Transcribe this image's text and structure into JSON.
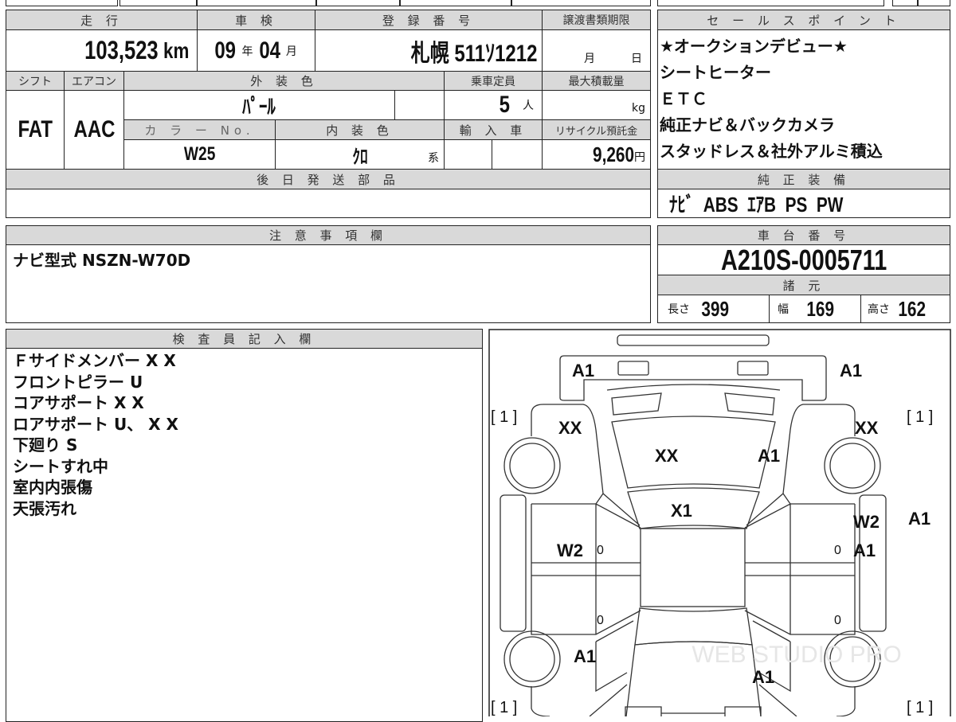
{
  "vehicle_table": {
    "mileage_header": "走 行",
    "mileage_value": "103,523",
    "mileage_unit": "km",
    "inspection_header": "車 検",
    "inspection_year": "09",
    "inspection_year_unit": "年",
    "inspection_month": "04",
    "inspection_month_unit": "月",
    "registration_header": "登 録 番 号",
    "registration_value": "札幌 511ｿ1212",
    "transfer_deadline_header": "譲渡書類期限",
    "transfer_month_unit": "月",
    "transfer_day_unit": "日",
    "shift_header": "シフト",
    "shift_value": "FAT",
    "aircon_header": "エアコン",
    "aircon_value": "AAC",
    "exterior_color_header": "外 装 色",
    "exterior_color_value": "ﾊﾟｰﾙ",
    "capacity_header": "乗車定員",
    "capacity_value": "5",
    "capacity_unit": "人",
    "max_load_header": "最大積載量",
    "max_load_unit": "kg",
    "color_no_header": "カ ラ ー No.",
    "color_no_value": "W25",
    "interior_color_header": "内 装 色",
    "interior_color_value": "ｸﾛ",
    "interior_color_suffix": "系",
    "import_header": "輸 入 車",
    "recycle_header": "リサイクル預託金",
    "recycle_value": "9,260",
    "recycle_unit": "円",
    "later_parts_header": "後 日 発 送 部 品"
  },
  "sales_points": {
    "header": "セ ー ル ス ポ イ ン ト",
    "items": [
      "★オークションデビュー★",
      "シートヒーター",
      "ＥＴＣ",
      "純正ナビ＆バックカメラ",
      "スタッドレス＆社外アルミ積込"
    ],
    "equipment_header": "純 正 装 備",
    "equipment_value": "ﾅﾋﾞ  ABS  ｴｱB  PS  PW"
  },
  "notes": {
    "header": "注 意 事 項 欄",
    "text": "ナビ型式 NSZN-W70D"
  },
  "chassis": {
    "header": "車 台 番 号",
    "value": "A210S-0005711",
    "specs_header": "諸 元",
    "length_label": "長さ",
    "length_value": "399",
    "width_label": "幅",
    "width_value": "169",
    "height_label": "高さ",
    "height_value": "162"
  },
  "inspector": {
    "header": "検 査 員 記 入 欄",
    "items": [
      "Ｆサイドメンバー X X",
      "フロントピラー U",
      "コアサポート X X",
      "ロアサポート U、 X X",
      "下廻り S",
      "シートすれ中",
      "室内内張傷",
      "天張汚れ"
    ]
  },
  "diagram": {
    "marks": {
      "front_left_corner": "A1",
      "front_right_corner": "A1",
      "bracket_fl": "[ 1 ]",
      "bracket_fr": "[ 1 ]",
      "bracket_rl": "[ 1 ]",
      "bracket_rr": "[ 1 ]",
      "fender_fl": "XX",
      "fender_fr": "XX",
      "hood_left": "XX",
      "hood_right": "A1",
      "windshield": "X1",
      "door_fr": "W2",
      "mirror_r": "A1",
      "door_fr_lower": "A1",
      "door_fl": "W2",
      "zero_fl": "0",
      "zero_fr": "0",
      "zero_rl": "0",
      "zero_rr": "0",
      "quarter_rl": "A1",
      "rear": "A1"
    },
    "watermark": "WEB STUDIO PRO"
  }
}
